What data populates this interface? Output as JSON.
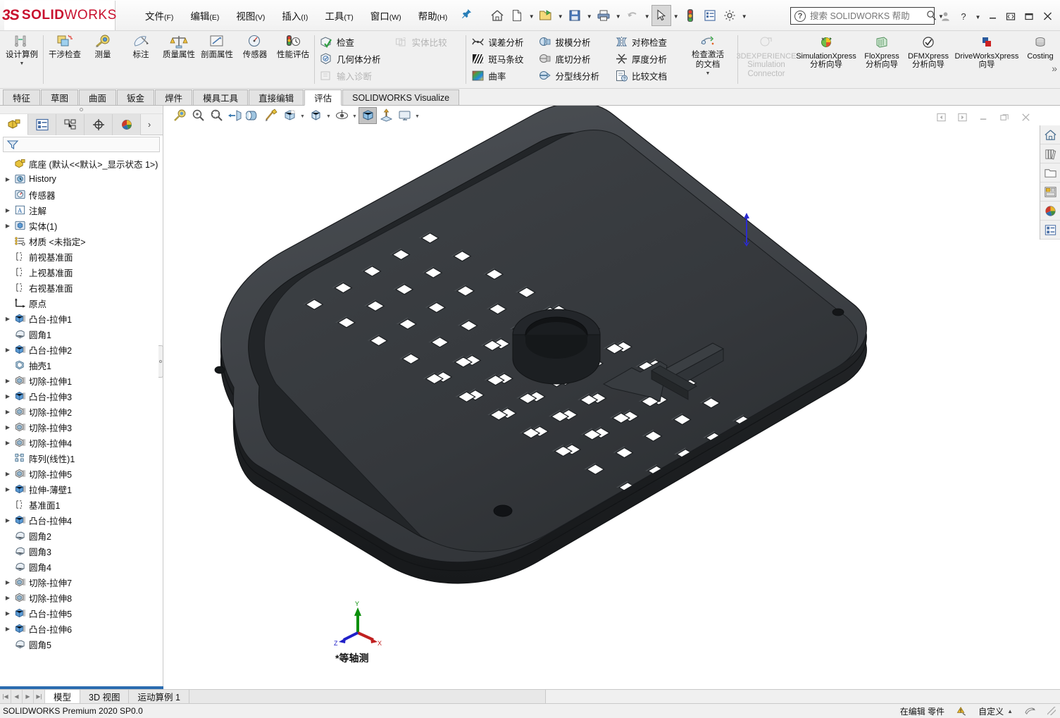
{
  "app": {
    "brand_prefix": "3S",
    "brand_main": "SOLID",
    "brand_light": "WORKS",
    "document_title": "底座",
    "status_version": "SOLIDWORKS Premium 2020 SP0.0"
  },
  "menu": [
    {
      "label": "文件",
      "mnemonic": "(F)"
    },
    {
      "label": "编辑",
      "mnemonic": "(E)"
    },
    {
      "label": "视图",
      "mnemonic": "(V)"
    },
    {
      "label": "插入",
      "mnemonic": "(I)"
    },
    {
      "label": "工具",
      "mnemonic": "(T)"
    },
    {
      "label": "窗口",
      "mnemonic": "(W)"
    },
    {
      "label": "帮助",
      "mnemonic": "(H)"
    }
  ],
  "search": {
    "placeholder": "搜索 SOLIDWORKS 帮助"
  },
  "ribbon": {
    "design_study": {
      "label": "设计算例"
    },
    "group_tools": [
      {
        "label": "干涉检查",
        "icon": "interference-icon"
      },
      {
        "label": "测量",
        "icon": "measure-icon"
      },
      {
        "label": "标注",
        "icon": "markup-icon"
      },
      {
        "label": "质量属性",
        "icon": "mass-properties-icon"
      },
      {
        "label": "剖面属性",
        "icon": "section-properties-icon"
      },
      {
        "label": "传感器",
        "icon": "sensor-icon"
      },
      {
        "label": "性能评估",
        "icon": "performance-icon"
      }
    ],
    "group_check": [
      {
        "label": "检查",
        "icon": "check-icon",
        "disabled": false
      },
      {
        "label": "几何体分析",
        "icon": "geometry-analysis-icon",
        "disabled": false
      },
      {
        "label": "输入诊断",
        "icon": "import-diagnostics-icon",
        "disabled": true
      }
    ],
    "group_compare": [
      {
        "label": "实体比较",
        "icon": "compare-body-icon",
        "disabled": true
      }
    ],
    "group_deviation": [
      {
        "label": "误差分析",
        "icon": "deviation-icon",
        "disabled": false
      },
      {
        "label": "斑马条纹",
        "icon": "zebra-stripes-icon",
        "disabled": false
      },
      {
        "label": "曲率",
        "icon": "curvature-icon",
        "disabled": false
      }
    ],
    "group_draft": [
      {
        "label": "拔模分析",
        "icon": "draft-analysis-icon"
      },
      {
        "label": "底切分析",
        "icon": "undercut-analysis-icon"
      },
      {
        "label": "分型线分析",
        "icon": "parting-line-icon"
      }
    ],
    "group_symmetry": [
      {
        "label": "对称检查",
        "icon": "symmetry-check-icon"
      },
      {
        "label": "厚度分析",
        "icon": "thickness-analysis-icon"
      },
      {
        "label": "比较文档",
        "icon": "compare-documents-icon"
      }
    ],
    "check_active": {
      "l1": "检查激活",
      "l2": "的文档"
    },
    "xpress": [
      {
        "l1": "3DEXPERIENCE",
        "l2": "Simulation",
        "l3": "Connector",
        "disabled": true,
        "icon": "3dexperience-icon"
      },
      {
        "l1": "SimulationXpress",
        "l2": "分析向导",
        "disabled": false,
        "icon": "simulationxpress-icon"
      },
      {
        "l1": "FloXpress",
        "l2": "分析向导",
        "disabled": false,
        "icon": "floxpress-icon"
      },
      {
        "l1": "DFMXpress",
        "l2": "分析向导",
        "disabled": false,
        "icon": "dfmxpress-icon"
      },
      {
        "l1": "DriveWorksXpress",
        "l2": "向导",
        "disabled": false,
        "icon": "driveworksxpress-icon"
      },
      {
        "l1": "Costing",
        "l2": "",
        "disabled": false,
        "icon": "costing-icon"
      }
    ]
  },
  "tabs": [
    {
      "label": "特征",
      "active": false
    },
    {
      "label": "草图",
      "active": false
    },
    {
      "label": "曲面",
      "active": false
    },
    {
      "label": "钣金",
      "active": false
    },
    {
      "label": "焊件",
      "active": false
    },
    {
      "label": "模具工具",
      "active": false
    },
    {
      "label": "直接编辑",
      "active": false
    },
    {
      "label": "评估",
      "active": true
    },
    {
      "label": "SOLIDWORKS Visualize",
      "active": false
    }
  ],
  "panel": {
    "tabs": [
      {
        "name": "feature-manager-tab",
        "icon": "feature-tree-icon",
        "active": true
      },
      {
        "name": "property-manager-tab",
        "icon": "property-list-icon",
        "active": false
      },
      {
        "name": "configuration-manager-tab",
        "icon": "configuration-icon",
        "active": false
      },
      {
        "name": "dimxpert-manager-tab",
        "icon": "dimxpert-icon",
        "active": false
      },
      {
        "name": "display-manager-tab",
        "icon": "appearance-sphere-icon",
        "active": false
      }
    ],
    "filter_icon": "filter-funnel-icon",
    "root": "底座  (默认<<默认>_显示状态 1>)",
    "tree": [
      {
        "label": "History",
        "icon": "history-icon",
        "expandable": true,
        "indent": 1
      },
      {
        "label": "传感器",
        "icon": "sensors-icon",
        "expandable": false,
        "indent": 1
      },
      {
        "label": "注解",
        "icon": "annotations-icon",
        "expandable": true,
        "indent": 1
      },
      {
        "label": "实体(1)",
        "icon": "solid-bodies-icon",
        "expandable": true,
        "indent": 1
      },
      {
        "label": "材质 <未指定>",
        "icon": "material-icon",
        "expandable": false,
        "indent": 1
      },
      {
        "label": "前视基准面",
        "icon": "plane-icon",
        "expandable": false,
        "indent": 1
      },
      {
        "label": "上视基准面",
        "icon": "plane-icon",
        "expandable": false,
        "indent": 1
      },
      {
        "label": "右视基准面",
        "icon": "plane-icon",
        "expandable": false,
        "indent": 1
      },
      {
        "label": "原点",
        "icon": "origin-icon",
        "expandable": false,
        "indent": 1
      },
      {
        "label": "凸台-拉伸1",
        "icon": "boss-extrude-icon",
        "expandable": true,
        "indent": 1
      },
      {
        "label": "圆角1",
        "icon": "fillet-icon",
        "expandable": false,
        "indent": 1
      },
      {
        "label": "凸台-拉伸2",
        "icon": "boss-extrude-icon",
        "expandable": true,
        "indent": 1
      },
      {
        "label": "抽壳1",
        "icon": "shell-icon",
        "expandable": false,
        "indent": 1
      },
      {
        "label": "切除-拉伸1",
        "icon": "cut-extrude-icon",
        "expandable": true,
        "indent": 1
      },
      {
        "label": "凸台-拉伸3",
        "icon": "boss-extrude-icon",
        "expandable": true,
        "indent": 1
      },
      {
        "label": "切除-拉伸2",
        "icon": "cut-extrude-icon",
        "expandable": true,
        "indent": 1
      },
      {
        "label": "切除-拉伸3",
        "icon": "cut-extrude-icon",
        "expandable": true,
        "indent": 1
      },
      {
        "label": "切除-拉伸4",
        "icon": "cut-extrude-icon",
        "expandable": true,
        "indent": 1
      },
      {
        "label": "阵列(线性)1",
        "icon": "linear-pattern-icon",
        "expandable": false,
        "indent": 1
      },
      {
        "label": "切除-拉伸5",
        "icon": "cut-extrude-icon",
        "expandable": true,
        "indent": 1
      },
      {
        "label": "拉伸-薄壁1",
        "icon": "thin-extrude-icon",
        "expandable": true,
        "indent": 1
      },
      {
        "label": "基准面1",
        "icon": "plane-icon",
        "expandable": false,
        "indent": 1
      },
      {
        "label": "凸台-拉伸4",
        "icon": "boss-extrude-icon",
        "expandable": true,
        "indent": 1
      },
      {
        "label": "圆角2",
        "icon": "fillet-icon",
        "expandable": false,
        "indent": 1
      },
      {
        "label": "圆角3",
        "icon": "fillet-icon",
        "expandable": false,
        "indent": 1
      },
      {
        "label": "圆角4",
        "icon": "fillet-icon",
        "expandable": false,
        "indent": 1
      },
      {
        "label": "切除-拉伸7",
        "icon": "cut-extrude-icon",
        "expandable": true,
        "indent": 1
      },
      {
        "label": "切除-拉伸8",
        "icon": "cut-extrude-icon",
        "expandable": true,
        "indent": 1
      },
      {
        "label": "凸台-拉伸5",
        "icon": "boss-extrude-icon",
        "expandable": true,
        "indent": 1
      },
      {
        "label": "凸台-拉伸6",
        "icon": "boss-extrude-icon",
        "expandable": true,
        "indent": 1
      },
      {
        "label": "圆角5",
        "icon": "fillet-icon",
        "expandable": false,
        "indent": 1
      }
    ]
  },
  "graphics": {
    "view_label": "*等轴测",
    "triad": {
      "x": "X",
      "y": "Y",
      "z": "Z"
    },
    "view_toolbar": [
      {
        "name": "zoom-to-fit-icon",
        "selected": false,
        "caret": false
      },
      {
        "name": "zoom-to-area-icon",
        "selected": false,
        "caret": false
      },
      {
        "name": "previous-view-icon",
        "selected": false,
        "caret": false
      },
      {
        "name": "section-view-icon",
        "selected": false,
        "caret": false
      },
      {
        "name": "view-orientation-icon",
        "selected": false,
        "caret": false
      },
      {
        "name": "apply-scene-icon",
        "selected": false,
        "caret": false
      },
      {
        "name": "view-orientation-cube-icon",
        "selected": false,
        "caret": true
      },
      {
        "name": "display-style-icon",
        "selected": false,
        "caret": true
      },
      {
        "name": "hide-show-items-icon",
        "selected": false,
        "caret": true
      },
      {
        "name": "edit-appearance-icon",
        "selected": true,
        "caret": false
      },
      {
        "name": "apply-scene-2-icon",
        "selected": false,
        "caret": false
      },
      {
        "name": "view-settings-icon",
        "selected": false,
        "caret": true
      }
    ],
    "right_dock": [
      {
        "name": "home-icon"
      },
      {
        "name": "library-icon"
      },
      {
        "name": "file-explorer-icon"
      },
      {
        "name": "view-palette-icon"
      },
      {
        "name": "appearances-icon"
      },
      {
        "name": "custom-properties-icon"
      }
    ]
  },
  "bottom": {
    "model_tabs": [
      {
        "label": "模型",
        "active": true
      },
      {
        "label": "3D 视图",
        "active": false
      },
      {
        "label": "运动算例 1",
        "active": false
      }
    ]
  },
  "status": {
    "version": "SOLIDWORKS Premium 2020 SP0.0",
    "edit_state": "在编辑 零件",
    "units": "自定义"
  },
  "colors": {
    "brand_red": "#c8102e",
    "accent_blue": "#2b6cb0",
    "model_dark": "#2e3033"
  }
}
